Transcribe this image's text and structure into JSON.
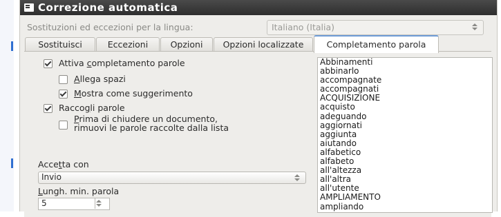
{
  "window": {
    "title": "Correzione automatica"
  },
  "language": {
    "label": "Sostituzioni ed eccezioni per la lingua:",
    "value": "Italiano (Italia)"
  },
  "tabs": [
    {
      "label": "Sostituisci"
    },
    {
      "label": "Eccezioni"
    },
    {
      "label": "Opzioni"
    },
    {
      "label": "Opzioni localizzate"
    },
    {
      "label": "Completamento parola",
      "active": true
    }
  ],
  "options": {
    "activate": {
      "label": "Attiva completamento parole",
      "checked": true
    },
    "append_spaces": {
      "label": "Allega spazi",
      "checked": false
    },
    "show_as_suggestion": {
      "label": "Mostra come suggerimento",
      "checked": true
    },
    "collect_words": {
      "label": "Raccogli parole",
      "checked": true
    },
    "remove_on_close": {
      "label_line1": "Prima di chiudere un documento,",
      "label_line2": "rimuovi le parole raccolte dalla lista",
      "checked": false
    }
  },
  "accept_with": {
    "label": "Accetta con",
    "value": "Invio"
  },
  "min_word_length": {
    "label": "Lungh. min. parola",
    "value": "5"
  },
  "words": [
    "Abbinamenti",
    "abbinarlo",
    "accompagnate",
    "accompagnati",
    "ACQUISIZIONE",
    "acquisto",
    "adeguando",
    "aggiornati",
    "aggiunta",
    "aiutando",
    "alfabetico",
    "alfabeto",
    "all'altezza",
    "all'altra",
    "all'utente",
    "AMPLIAMENTO",
    "ampliando"
  ]
}
